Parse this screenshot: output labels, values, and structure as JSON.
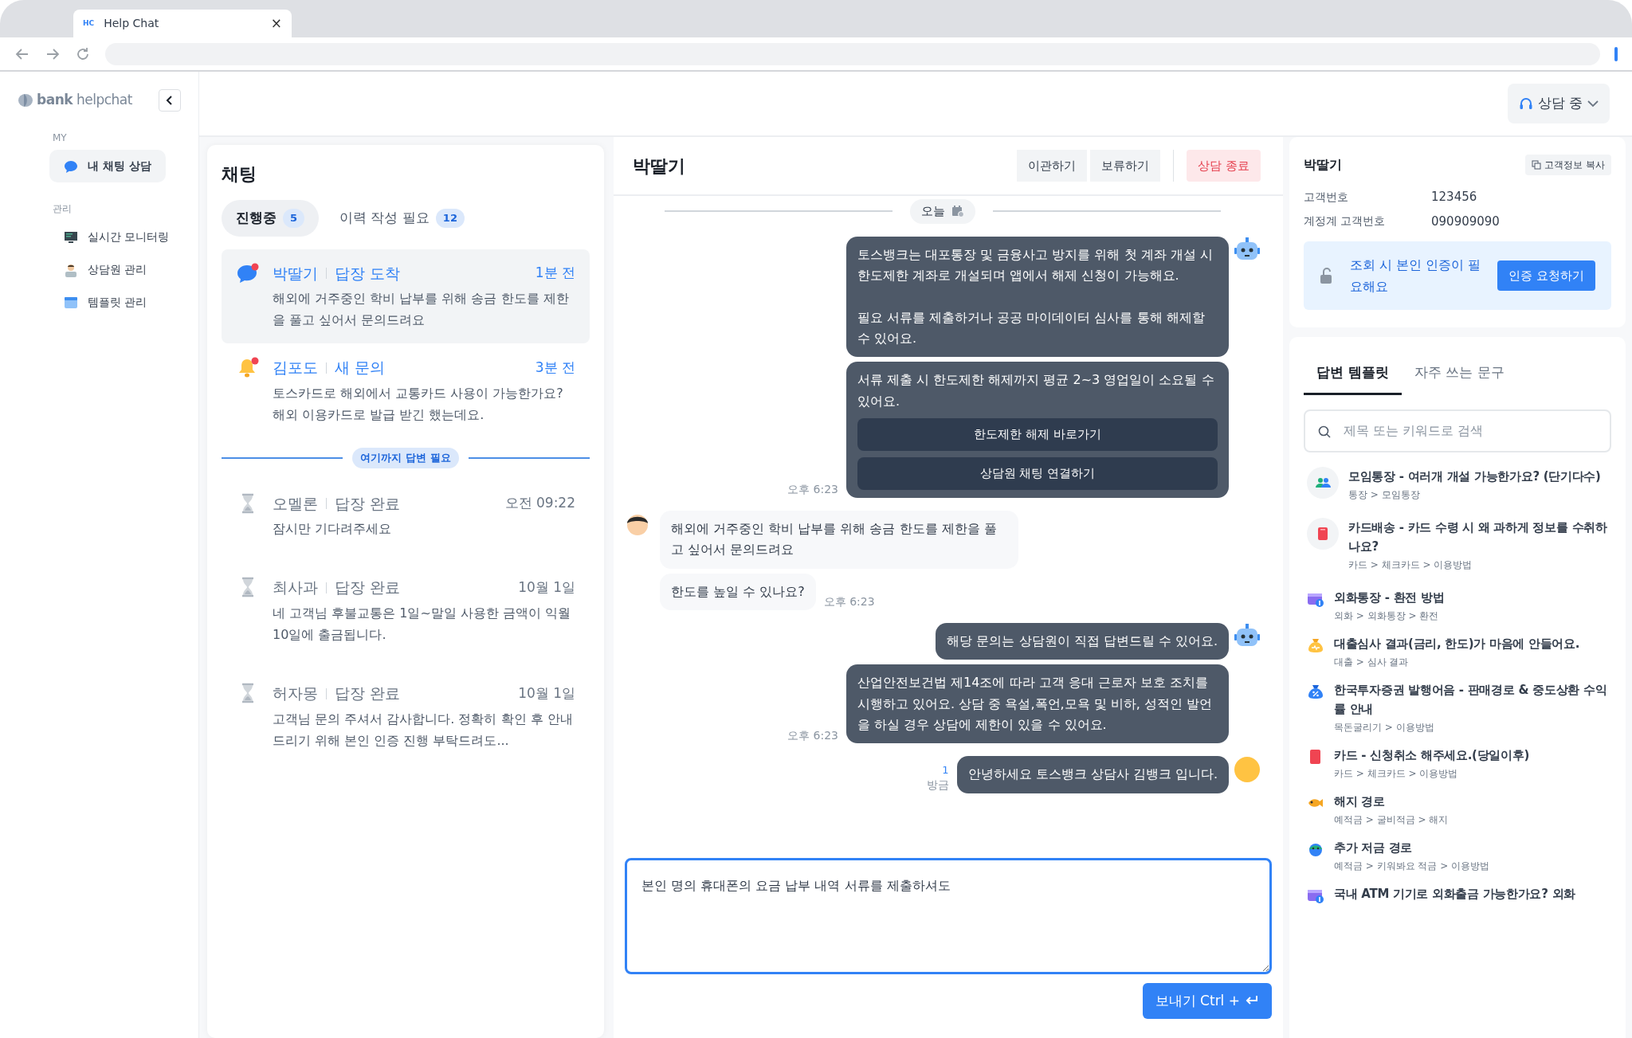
{
  "browser": {
    "tab_icon": "HC",
    "tab_title": "Help Chat",
    "tab_close": "×"
  },
  "sidebar": {
    "logo": "**bank** helpchat",
    "sections": [
      {
        "label": "MY",
        "items": [
          {
            "label": "내 채팅 상담",
            "selected": true
          }
        ]
      },
      {
        "label": "관리",
        "items": [
          {
            "label": "실시간 모니터링",
            "selected": false
          },
          {
            "label": "상담원 관리",
            "selected": false
          },
          {
            "label": "템플릿 관리",
            "selected": false
          }
        ]
      }
    ]
  },
  "header": {
    "status_button": "상담 중"
  },
  "chat_list": {
    "title": "채팅",
    "tabs": [
      {
        "label": "진행중",
        "count": "5",
        "selected": true
      },
      {
        "label": "이력 작성 필요",
        "count": "12",
        "selected": false
      }
    ],
    "pending": [
      {
        "kind": "reply",
        "name": "박딸기",
        "status": "답장 도착",
        "time": "1분 전",
        "preview": "해외에 거주중인 학비 납부를 위해 송금 한도를 제한을 풀고 싶어서 문의드려요",
        "unread": true,
        "selected": true
      },
      {
        "kind": "new",
        "name": "김포도",
        "status": "새 문의",
        "time": "3분 전",
        "preview": "토스카드로 해외에서 교통카드 사용이 가능한가요? 해외 이용카드로 발급 받긴 했는데요.",
        "unread": true,
        "selected": false
      }
    ],
    "divider": "여기까지 답변 필요",
    "answered": [
      {
        "kind": "done",
        "name": "오멜론",
        "status": "답장 완료",
        "time": "오전 09:22",
        "preview": "잠시만 기다려주세요",
        "selected": false
      },
      {
        "kind": "done",
        "name": "최사과",
        "status": "답장 완료",
        "time": "10월 1일",
        "preview": "네 고객님 후불교통은 1일~말일 사용한 금액이 익월 10일에 출금됩니다.",
        "selected": false
      },
      {
        "kind": "done",
        "name": "허자몽",
        "status": "답장 완료",
        "time": "10월 1일",
        "preview": "고객님 문의 주셔서 감사합니다. 정확히 확인 후 안내드리기 위해 본인 인증 진행 부탁드려도...",
        "selected": false
      }
    ]
  },
  "conversation": {
    "customer_name": "박딸기",
    "actions": [
      {
        "label": "이관하기",
        "kind": "plain"
      },
      {
        "label": "보류하기",
        "kind": "plain"
      },
      {
        "label": "상담 종료",
        "kind": "danger"
      }
    ],
    "date_divider": "오늘",
    "messages": [
      {
        "kind": "bot",
        "bubbles": [
          {
            "text": "토스뱅크는 대포통장 및 금융사고 방지를 위해 첫 계좌 개설 시 한도제한 계좌로 개설되며 앱에서 해제 신청이 가능해요.\n\n필요 서류를 제출하거나 공공 마이데이터 심사를 통해 해제할 수 있어요."
          },
          {
            "text": "서류 제출 시 한도제한 해제까지 평균 2~3 영업일이 소요될 수 있어요.",
            "buttons": [
              "한도제한 해제 바로가기",
              "상담원 채팅 연결하기"
            ]
          }
        ],
        "time": "오후 6:23"
      },
      {
        "kind": "customer",
        "bubbles": [
          {
            "text": "해외에 거주중인 학비 납부를 위해 송금 한도를 제한을 풀고 싶어서 문의드려요"
          },
          {
            "text": "한도를 높일 수 있나요?"
          }
        ],
        "time": "오후 6:23"
      },
      {
        "kind": "bot",
        "bubbles": [
          {
            "text": "해당 문의는 상담원이 직접 답변드릴 수 있어요."
          },
          {
            "text": "산업안전보건법 제14조에 따라 고객 응대 근로자 보호 조치를 시행하고 있어요. 상담 중 욕설,폭언,모욕 및 비하, 성적인 발언을 하실 경우 상담에 제한이 있을 수 있어요."
          }
        ],
        "time": "오후 6:23"
      },
      {
        "kind": "agent",
        "bubbles": [
          {
            "text": "안녕하세요 토스뱅크 상담사 김뱅크 입니다."
          }
        ],
        "unread_count": "1",
        "time": "방금"
      }
    ],
    "composer": {
      "value": "본인 명의 휴대폰의 요금 납부 내역 서류를 제출하셔도",
      "send_button": "보내기 Ctrl +"
    }
  },
  "customer": {
    "name": "박딸기",
    "copy_button": "고객정보 복사",
    "fields": [
      {
        "label": "고객번호",
        "value": "123456"
      },
      {
        "label": "계정계 고객번호",
        "value": "090909090"
      }
    ],
    "auth_notice": "조회 시 본인 인증이 필요해요",
    "auth_button": "인증 요청하기"
  },
  "templates": {
    "tabs": [
      {
        "label": "답변 템플릿",
        "selected": true
      },
      {
        "label": "자주 쓰는 문구",
        "selected": false
      }
    ],
    "search": {
      "placeholder": "제목 또는 키워드로 검색"
    },
    "items": [
      {
        "title": "모임통장 - 여러개 개설 가능한가요? (단기다수)",
        "path": "통장 > 모임통장"
      },
      {
        "title": "카드배송 - 카드 수령 시 왜 과하게 정보를 수취하나요?",
        "path": "카드 > 체크카드 > 이용방법"
      },
      {
        "title": "외화통장 - 환전 방법",
        "path": "외화 > 외화통장 > 환전"
      },
      {
        "title": "대출심사 결과(금리, 한도)가 마음에 안들어요.",
        "path": "대출 > 심사 결과"
      },
      {
        "title": "한국투자증권 발행어음 - 판매경로 & 중도상환 수익률 안내",
        "path": "목돈굴리기 > 이용방법"
      },
      {
        "title": "카드 - 신청취소 해주세요.(당일이후)",
        "path": "카드 > 체크카드 > 이용방법"
      },
      {
        "title": "해지 경로",
        "path": "예적금 > 굴비적금 > 해지"
      },
      {
        "title": "추가 저금 경로",
        "path": "예적금 > 키워봐요 적금 > 이용방법"
      },
      {
        "title": "국내 ATM 기기로 외화출금 가능한가요? 외화"
      }
    ]
  }
}
